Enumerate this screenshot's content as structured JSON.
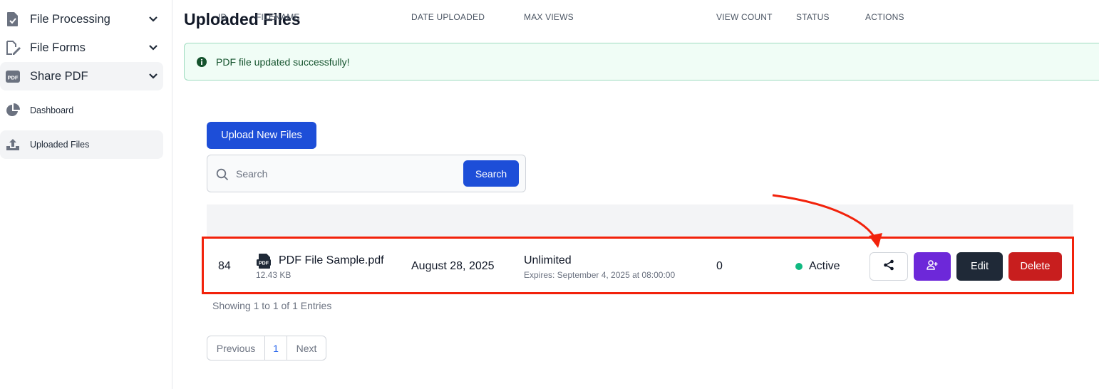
{
  "sidebar": {
    "groups": [
      {
        "label": "File Processing"
      },
      {
        "label": "File Forms"
      },
      {
        "label": "Share PDF"
      }
    ],
    "items": [
      {
        "label": "Dashboard"
      },
      {
        "label": "Uploaded Files"
      }
    ]
  },
  "main": {
    "title": "Uploaded Files",
    "alert": "PDF file updated successfully!",
    "upload_label": "Upload New Files",
    "search": {
      "placeholder": "Search",
      "button_label": "Search"
    },
    "table": {
      "columns": [
        "ID",
        "FILENAME",
        "DATE UPLOADED",
        "MAX VIEWS",
        "VIEW COUNT",
        "STATUS",
        "ACTIONS"
      ],
      "rows": [
        {
          "id": "84",
          "filename": "PDF File Sample.pdf",
          "size": "12.43 KB",
          "date_uploaded": "August 28, 2025",
          "max_views": "Unlimited",
          "expires": "Expires: September 4, 2025 at 08:00:00",
          "view_count": "0",
          "status": "Active",
          "actions": {
            "edit": "Edit",
            "delete": "Delete"
          }
        }
      ]
    },
    "showing": "Showing 1 to 1 of 1 Entries",
    "pagination": {
      "previous": "Previous",
      "page": "1",
      "next": "Next"
    }
  },
  "colors": {
    "primary": "#1d4ed8",
    "purple": "#6d28d9",
    "dark": "#1f2937",
    "danger": "#c81e1e",
    "success": "#10b981",
    "highlight": "#f2220b"
  },
  "icons": {
    "file_processing": "file-check-icon",
    "file_forms": "file-pen-icon",
    "share_pdf": "pdf-icon",
    "dashboard": "pie-chart-icon",
    "uploaded_files": "upload-icon",
    "share": "share-icon",
    "add_user": "user-plus-icon"
  }
}
